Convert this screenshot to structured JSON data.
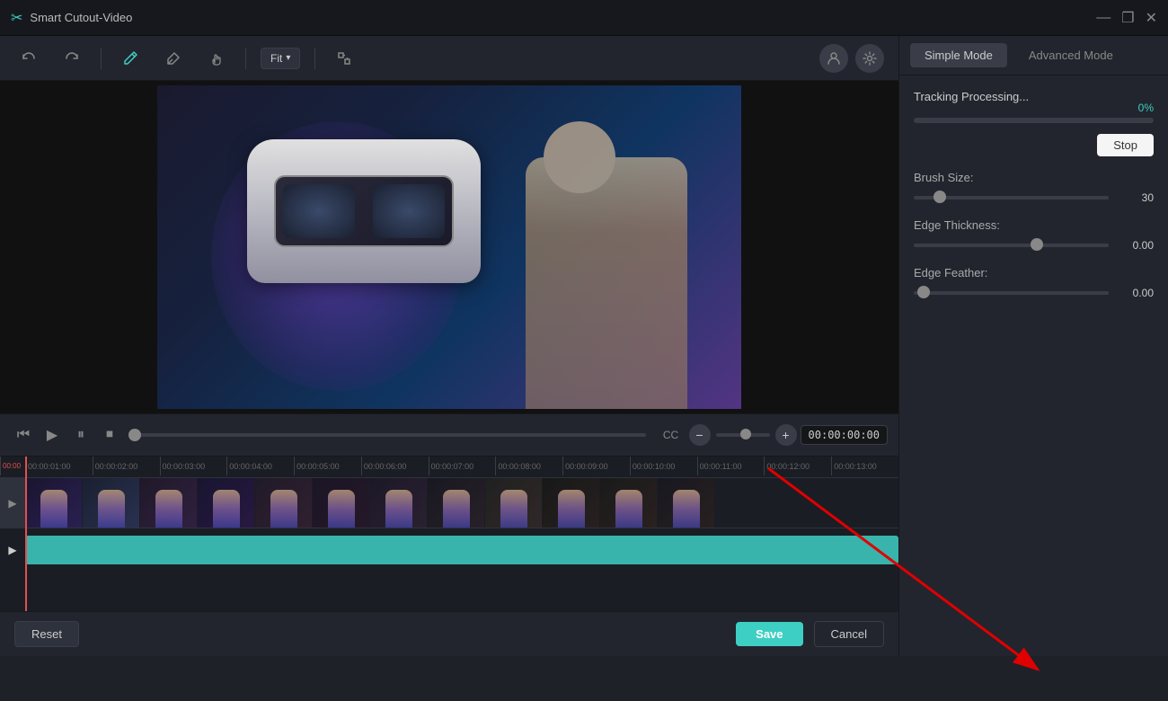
{
  "app": {
    "title": "Smart Cutout-Video"
  },
  "toolbar": {
    "undo_label": "↩",
    "redo_label": "↪",
    "pencil_label": "✏",
    "eraser_label": "⌫",
    "hand_label": "✋",
    "fit_label": "Fit",
    "fit_arrow": "▾",
    "transform_label": "⇄"
  },
  "video": {
    "time_display": "00:00:00:00"
  },
  "right_panel": {
    "mode_tabs": [
      {
        "label": "Simple Mode",
        "active": true
      },
      {
        "label": "Advanced Mode",
        "active": false
      }
    ],
    "tracking_label": "Tracking Processing...",
    "tracking_percent": "0%",
    "stop_button": "Stop",
    "brush_size_label": "Brush Size:",
    "brush_size_value": "30",
    "brush_size_thumb_pct": "10",
    "edge_thickness_label": "Edge Thickness:",
    "edge_thickness_value": "0.00",
    "edge_thickness_thumb_pct": "60",
    "edge_feather_label": "Edge Feather:",
    "edge_feather_value": "0.00",
    "edge_feather_thumb_pct": "2"
  },
  "timeline": {
    "marks": [
      "00:00",
      "00:00:01:00",
      "00:00:02:00",
      "00:00:03:00",
      "00:00:04:00",
      "00:00:05:00",
      "00:00:06:00",
      "00:00:07:00",
      "00:00:08:00",
      "00:00:09:00",
      "00:00:10:00",
      "00:00:11:00",
      "00:00:12:00",
      "00:00:13:00"
    ]
  },
  "bottom_bar": {
    "reset_label": "Reset",
    "save_label": "Save",
    "cancel_label": "Cancel"
  },
  "window_controls": {
    "minimize": "—",
    "maximize": "❐",
    "close": "✕"
  }
}
